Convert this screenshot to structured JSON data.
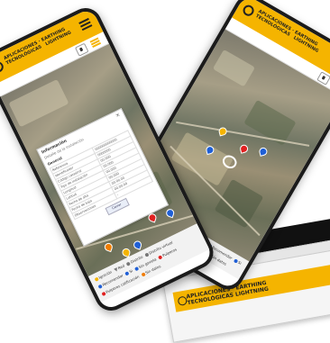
{
  "brand": {
    "line1": "APLICACIONES · EARTHING",
    "line2": "TECNOLÓGICAS   LIGHTNING",
    "primary_color": "#f5b400",
    "dark_color": "#111111"
  },
  "icons": {
    "menu": "menu-icon",
    "locate": "location-icon",
    "layers": "layers-icon",
    "logo": "at-logo"
  },
  "legend": {
    "items": [
      {
        "label": "Ignición",
        "color": "#f5b400"
      },
      {
        "label": "Red",
        "color": "#777777"
      },
      {
        "label": "Distrito",
        "color": "#777777"
      },
      {
        "label": "Distrito virtual",
        "color": "#777777"
      },
      {
        "label": "Recomendar",
        "color": "#1f5fd6"
      },
      {
        "label": "Si",
        "color": "#1f5fd6"
      },
      {
        "label": "Sin gaveta",
        "color": "#1f5fd6"
      },
      {
        "label": "Pulperos",
        "color": "#e02020"
      },
      {
        "label": "Pulperos calificación",
        "color": "#e02020"
      },
      {
        "label": "Sin datos",
        "color": "#f07d00"
      }
    ]
  },
  "front_detail": {
    "title": "Información",
    "subtitle": "Detalle de la instalación",
    "section": "General",
    "rows": [
      {
        "k": "Referencia",
        "v": "000000000000"
      },
      {
        "k": "Identificador",
        "v": "0000000"
      },
      {
        "k": "Código catastral",
        "v": "00.000"
      },
      {
        "k": "Tipo de instalación",
        "v": "00.000"
      },
      {
        "k": "Longitud",
        "v": "00.000"
      },
      {
        "k": "Latitud",
        "v": "00.000"
      },
      {
        "k": "Fecha de alta",
        "v": "00.00.00"
      },
      {
        "k": "Fecha de baja",
        "v": "00.00.00"
      },
      {
        "k": "Observaciones",
        "v": "-"
      }
    ],
    "button": "Cerrar"
  }
}
